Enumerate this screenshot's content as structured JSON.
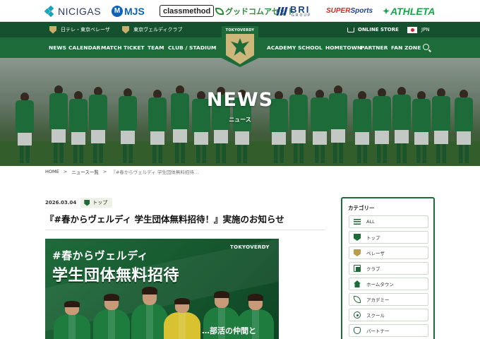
{
  "sponsors": {
    "nicigas": "NICIGAS",
    "mjs": "MJS",
    "mjs_mark": "M",
    "classmethod": "classmethod",
    "goodcom": "グッドコムアセット",
    "bri": "BRI",
    "bri_sub": "GROUP",
    "supersports_prefix": "SUPER",
    "supersports": "Sports",
    "athleta": "ATHLETA"
  },
  "topbar": {
    "club_link_1": "日テレ・東京ベレーザ",
    "club_link_2": "東京ヴェルディクラブ",
    "online_store": "ONLINE STORE",
    "language": "JPN"
  },
  "nav": {
    "items_left": [
      "NEWS",
      "CALENDAR",
      "MATCH",
      "TICKET",
      "TEAM",
      "CLUB / STADIUM"
    ],
    "items_right": [
      "ACADEMY",
      "SCHOOL",
      "HOMETOWN",
      "PARTNER",
      "FAN ZONE"
    ],
    "emblem_text": "TOKYOVERDY"
  },
  "hero": {
    "title": "NEWS",
    "subtitle": "ニュース"
  },
  "breadcrumb": {
    "home": "HOME",
    "sep": ">",
    "list": "ニュース一覧",
    "current": "『#春からヴェルディ 学生団体無料招待…"
  },
  "article": {
    "date": "2026.03.04",
    "category": "トップ",
    "title": "『#春からヴェルディ 学生団体無料招待！』実施のお知らせ",
    "banner": {
      "logo": "TOKYOVERDY",
      "line1": "#春からヴェルディ",
      "line2": "学生団体無料招待",
      "line3": "…部活の仲間と"
    }
  },
  "sidebar": {
    "title": "カテゴリー",
    "items": [
      {
        "label": "ALL",
        "icon": "list-icon"
      },
      {
        "label": "トップ",
        "icon": "verdy-crest-icon"
      },
      {
        "label": "ベレーザ",
        "icon": "beleza-crest-icon"
      },
      {
        "label": "クラブ",
        "icon": "club-icon"
      },
      {
        "label": "ホームタウン",
        "icon": "home-icon"
      },
      {
        "label": "アカデミー",
        "icon": "academy-icon"
      },
      {
        "label": "スクール",
        "icon": "ball-icon"
      },
      {
        "label": "パートナー",
        "icon": "handshake-icon"
      }
    ]
  },
  "colors": {
    "brand_green": "#1d6b39",
    "dark_green": "#15512f",
    "gold": "#c8b06a"
  }
}
